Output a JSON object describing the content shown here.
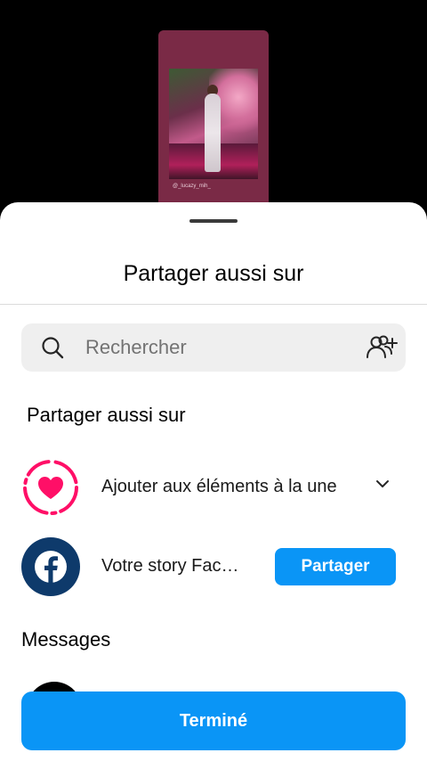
{
  "preview": {
    "caption": "@_lucazy_mih_"
  },
  "sheet": {
    "title": "Partager aussi sur",
    "search": {
      "placeholder": "Rechercher",
      "icon": "search-icon",
      "action_icon": "add-people-icon"
    },
    "section_label": "Partager aussi sur",
    "options": [
      {
        "label": "Ajouter aux éléments à la une",
        "icon": "highlight-heart-icon",
        "accent": "#ff0f67"
      },
      {
        "label": "Votre story Fac…",
        "icon": "facebook-icon",
        "accent": "#0e3a6b",
        "button": "Partager"
      }
    ],
    "messages_label": "Messages",
    "done_label": "Terminé"
  },
  "colors": {
    "primary_blue": "#0a95f6",
    "search_bg": "#efefef"
  }
}
